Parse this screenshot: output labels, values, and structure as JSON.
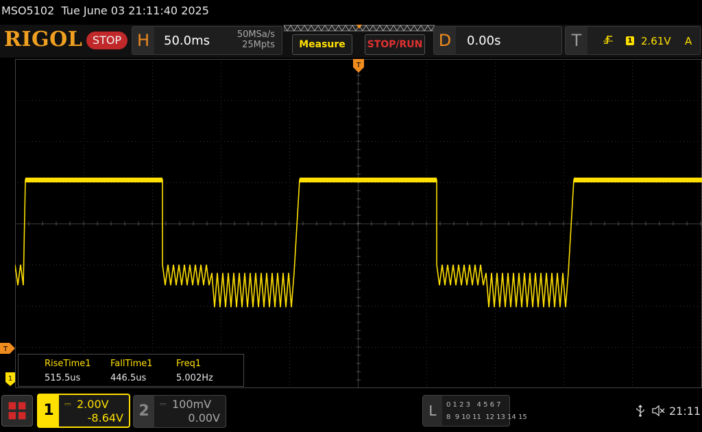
{
  "status": {
    "model": "MSO5102",
    "datetime": "Tue June 03 21:11:40 2025"
  },
  "header": {
    "logo": "RIGOL",
    "run_state": "STOP",
    "horizontal": {
      "letter": "H",
      "scale": "50.0ms",
      "sample_rate": "50MSa/s",
      "memory_depth": "25Mpts"
    },
    "measure_label": "Measure",
    "stoprun_label": "STOP/RUN",
    "delay": {
      "letter": "D",
      "value": "0.00s"
    },
    "trigger": {
      "letter": "T",
      "edge_icon": "rising-edge-icon",
      "channel": "1",
      "level": "2.61V",
      "mode": "A"
    }
  },
  "markers": {
    "trigger_position": "T",
    "trigger_level": "T",
    "ch1_ground": "1"
  },
  "measurements": [
    {
      "label": "RiseTime1",
      "value": "515.5us"
    },
    {
      "label": "FallTime1",
      "value": "446.5us"
    },
    {
      "label": "Freq1",
      "value": "5.002Hz"
    }
  ],
  "channels": {
    "ch1": {
      "number": "1",
      "coupling": "⎓",
      "scale": "2.00V",
      "offset": "-8.64V"
    },
    "ch2": {
      "number": "2",
      "coupling": "⎓",
      "scale": "100mV",
      "offset": "0.00V"
    }
  },
  "logic": {
    "letter": "L",
    "row1": "0 1 2 3   4 5 6 7",
    "row2": "8  9 10 11  12 13 14 15"
  },
  "system": {
    "usb_icon": "usb-icon",
    "speaker_icon": "speaker-muted-icon",
    "clock": "21:11"
  },
  "colors": {
    "ch1": "#ffe000",
    "accent_orange": "#f08c1e",
    "stop_red": "#c0282a",
    "grid": "#3a3a3a"
  },
  "waveform": {
    "channel": "1",
    "frequency_hz": 5.002,
    "shape": "square with ringing low state"
  }
}
